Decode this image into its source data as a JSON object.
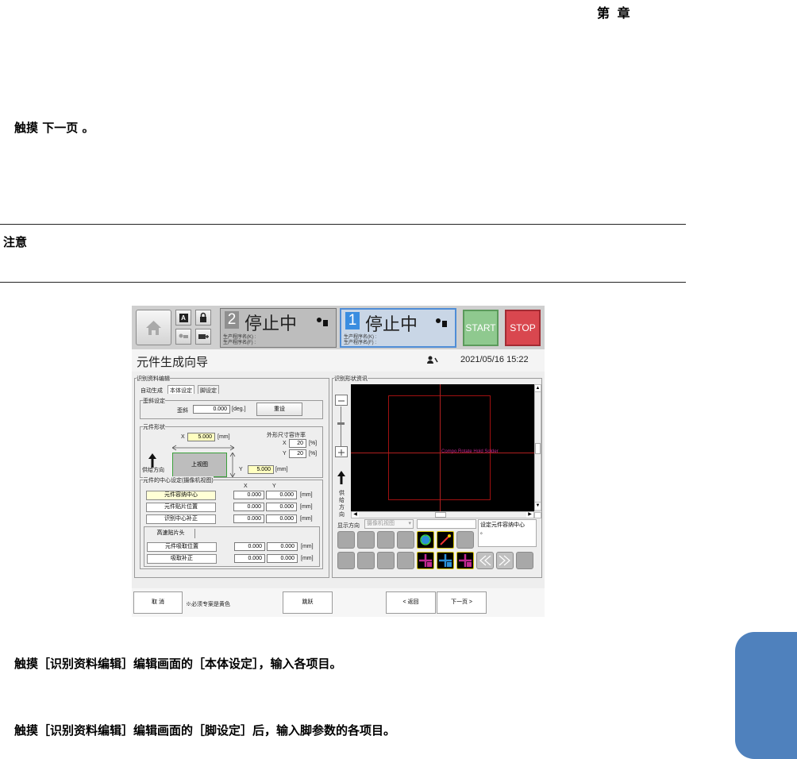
{
  "header": {
    "chapter_label": "第  章"
  },
  "steps": {
    "step1": "触摸 下一页 。",
    "step2": "触摸［识别资料编辑］编辑画面的［本体设定］，输入各项目。",
    "step3": "触摸［识别资料编辑］编辑画面的［脚设定］后，输入脚参数的各项目。"
  },
  "note": {
    "title": "注意"
  },
  "screen": {
    "lane2": {
      "num": "2",
      "status": "停止中",
      "prog_k": "生产程序名(K) :",
      "prog_f": "生产程序名(F) :"
    },
    "lane1": {
      "num": "1",
      "status": "停止中",
      "prog_k": "生产程序名(K) :",
      "prog_f": "生产程序名(F) :"
    },
    "start_label": "START",
    "stop_label": "STOP",
    "title": "元件生成向导",
    "datetime": "2021/05/16 15:22",
    "left_group": "识别资料编辑",
    "tabs": [
      "自动生成",
      "本体设定",
      "脚设定"
    ],
    "tilt": {
      "group": "歪斜设定",
      "label": "歪斜",
      "value": "0.000",
      "unit": "[deg.]",
      "reset": "重设"
    },
    "shape": {
      "group": "元件形状",
      "x_label": "X",
      "x_value": "5.000",
      "x_unit": "[mm]",
      "y_label": "Y",
      "y_value": "5.000",
      "y_unit": "[mm]",
      "tol_title": "外形尺寸容许率",
      "tol_x_label": "X",
      "tol_x": "20",
      "tol_y_label": "Y",
      "tol_y": "20",
      "pct": "[%]",
      "top_view": "上视图",
      "feed_dir": "供给方向"
    },
    "center": {
      "group": "元件的中心设定(摄像机视图)",
      "col_x": "X",
      "col_y": "Y",
      "rows": [
        {
          "label": "元件容纳中心",
          "x": "0.000",
          "y": "0.000",
          "unit": "[mm]"
        },
        {
          "label": "元件贴片位置",
          "x": "0.000",
          "y": "0.000",
          "unit": "[mm]"
        },
        {
          "label": "识别中心补正",
          "x": "0.000",
          "y": "0.000",
          "unit": "[mm]"
        }
      ],
      "high_speed": "高速贴片头",
      "rows2": [
        {
          "label": "元件吸取位置",
          "x": "0.000",
          "y": "0.000",
          "unit": "[mm]"
        },
        {
          "label": "吸取补正",
          "x": "0.000",
          "y": "0.000",
          "unit": "[mm]"
        }
      ]
    },
    "right_group": "识别形状资讯",
    "canvas_label": "Compo.Rotate Hold Solder",
    "feed_vertical": [
      "供",
      "给",
      "方",
      "向"
    ],
    "display_dir_label": "显示方向",
    "display_dir_value": "摄像机视图",
    "status_msg": "设定元件容纳中心",
    "status_msg2": "。",
    "footer": {
      "cancel": "取 消",
      "note": "※必须专案是黄色",
      "jump": "跳跃",
      "back": "< 返回",
      "next": "下一页 >"
    },
    "colors": {
      "start": "#8fc98f",
      "stop": "#d9474f",
      "lane_active": "#3a8de0",
      "canvas": "#000000"
    }
  }
}
